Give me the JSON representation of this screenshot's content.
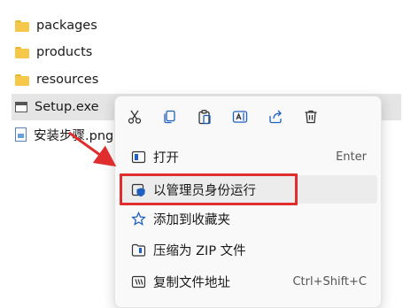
{
  "files": [
    {
      "name": "packages",
      "icon": "folder-icon"
    },
    {
      "name": "products",
      "icon": "folder-icon"
    },
    {
      "name": "resources",
      "icon": "folder-icon"
    },
    {
      "name": "Setup.exe",
      "icon": "exe-icon",
      "selected": true
    },
    {
      "name": "安装步骤.png",
      "icon": "png-icon"
    }
  ],
  "context_menu": {
    "toolbar": [
      "cut-icon",
      "copy-icon",
      "paste-icon",
      "rename-icon",
      "share-icon",
      "delete-icon"
    ],
    "items": [
      {
        "label": "打开",
        "shortcut": "Enter",
        "icon": "open-icon"
      },
      {
        "label": "以管理员身份运行",
        "shortcut": "",
        "icon": "shield-icon"
      },
      {
        "label": "添加到收藏夹",
        "shortcut": "",
        "icon": "star-icon"
      },
      {
        "label": "压缩为 ZIP 文件",
        "shortcut": "",
        "icon": "zip-icon"
      },
      {
        "label": "复制文件地址",
        "shortcut": "Ctrl+Shift+C",
        "icon": "path-icon"
      }
    ]
  },
  "colors": {
    "icon_blue": "#1f5fbf",
    "highlight_red": "#e02d2d",
    "selection_gray": "#e5e5e5"
  }
}
